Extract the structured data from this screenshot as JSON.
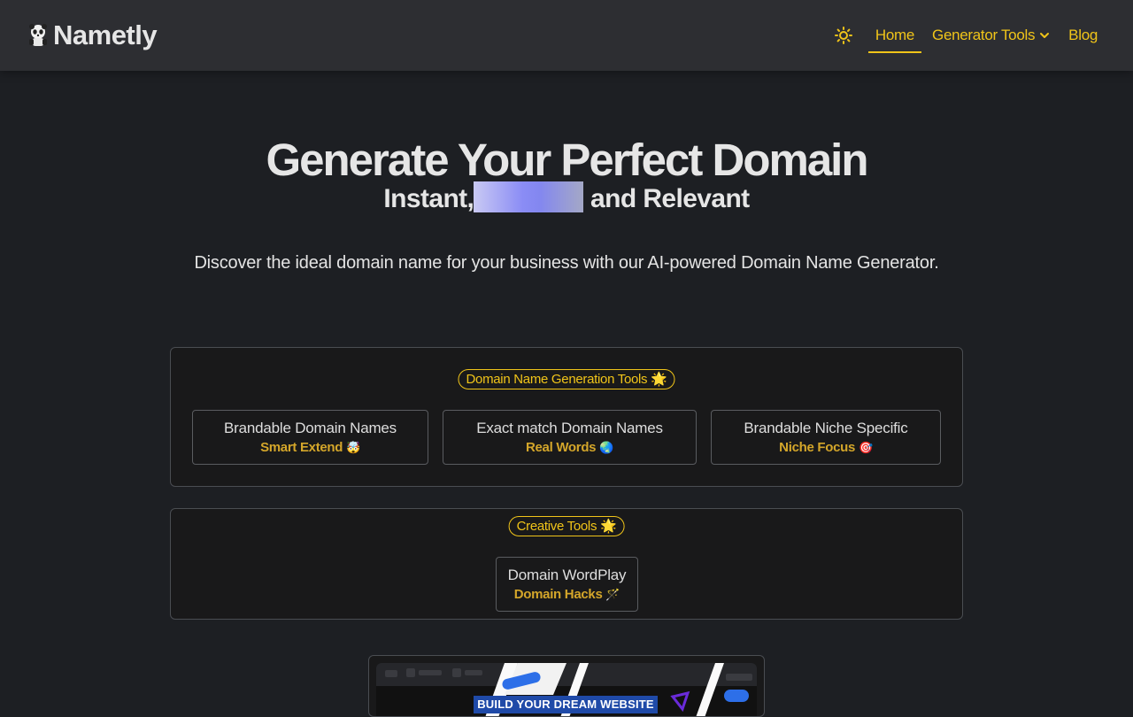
{
  "header": {
    "logo_text": "Nametly",
    "logo_icon": "panda-icon",
    "theme_icon": "sun-icon",
    "nav": {
      "home": "Home",
      "generator_tools": "Generator Tools",
      "blog": "Blog"
    }
  },
  "hero": {
    "title": "Generate Your Perfect Domain",
    "subtitle_prefix": "Instant,",
    "subtitle_suffix": "and Relevant",
    "description": "Discover the ideal domain name for your business with our AI-powered Domain Name Generator."
  },
  "generation_tools": {
    "label": "Domain Name Generation Tools 🌟",
    "cards": [
      {
        "title": "Brandable Domain Names",
        "subtitle": "Smart Extend",
        "emoji": "🤯"
      },
      {
        "title": "Exact match Domain Names",
        "subtitle": "Real Words",
        "emoji": "🌏"
      },
      {
        "title": "Brandable Niche Specific",
        "subtitle": "Niche Focus",
        "emoji": "🎯"
      }
    ]
  },
  "creative_tools": {
    "label": "Creative Tools 🌟",
    "cards": [
      {
        "title": "Domain WordPlay",
        "subtitle": "Domain Hacks",
        "emoji": "🪄"
      }
    ]
  },
  "promo": {
    "banner_text": "BUILD YOUR DREAM WEBSITE"
  },
  "colors": {
    "accent": "#f0c419",
    "background": "#1d1f23",
    "header": "#2d2e32"
  }
}
